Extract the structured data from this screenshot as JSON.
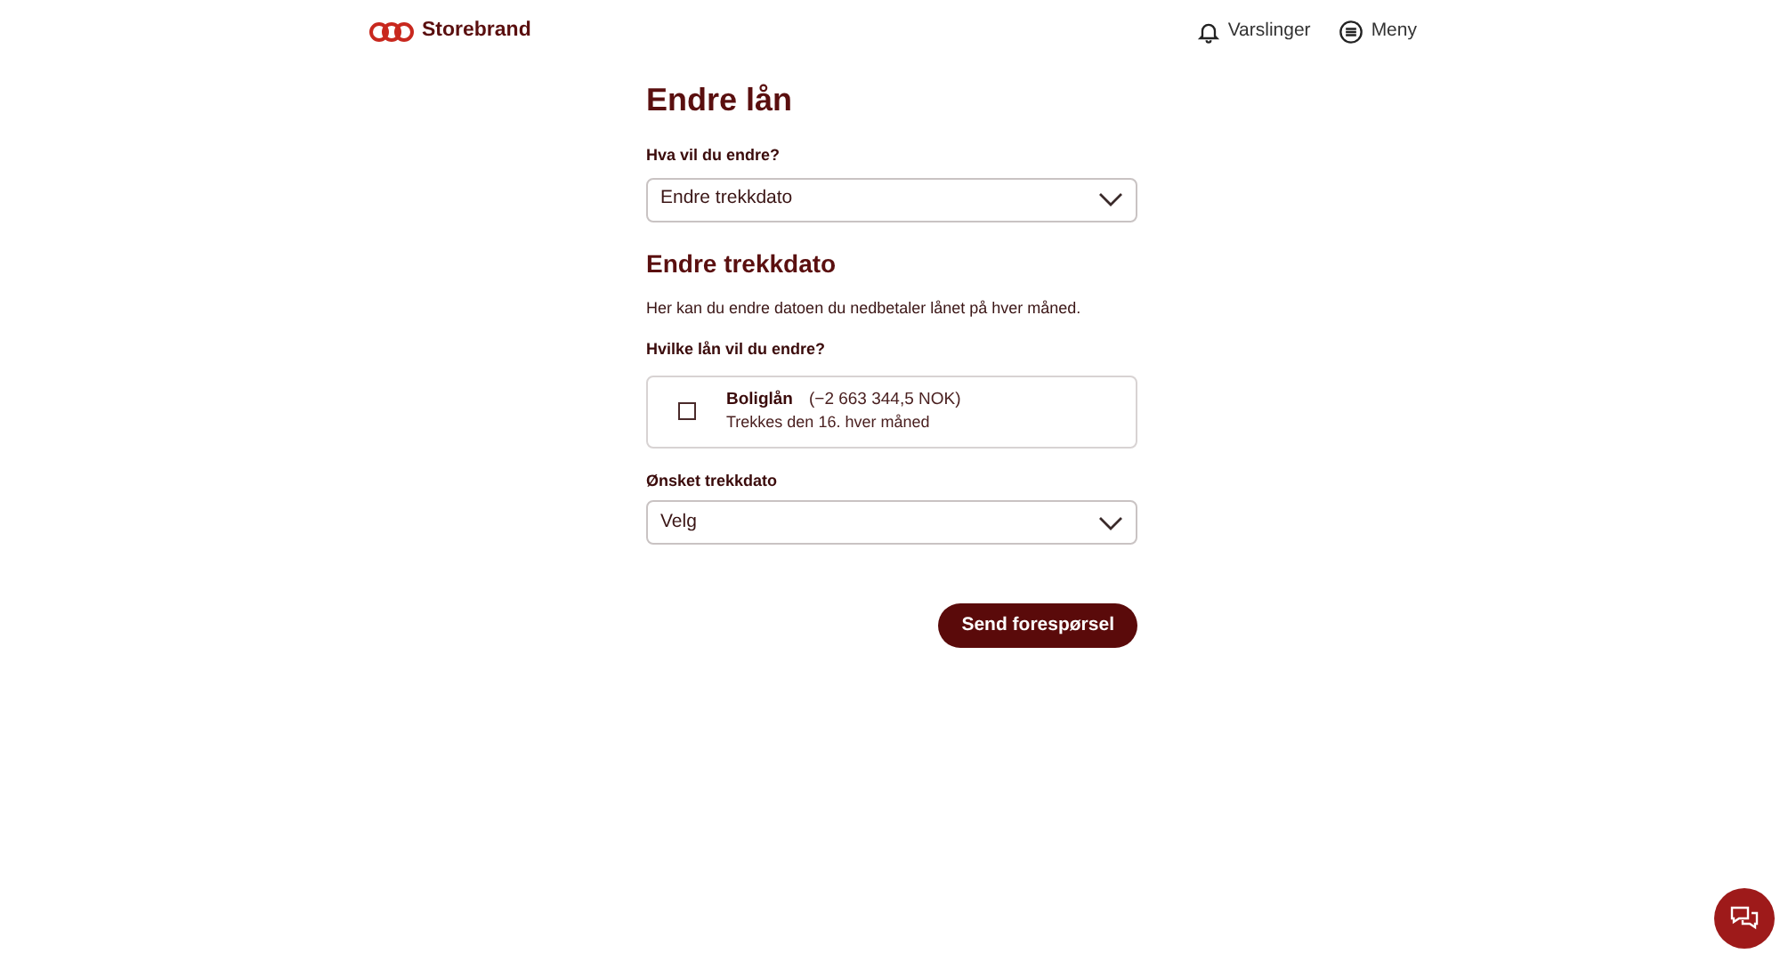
{
  "header": {
    "logo": "Storebrand",
    "nav": [
      {
        "kind": "bell",
        "label": "Varslinger"
      },
      {
        "kind": "menu",
        "label": "Meny"
      }
    ]
  },
  "title": "Endre lån",
  "change_field": {
    "label": "Hva vil du endre?",
    "value": "Endre trekkdato"
  },
  "section": {
    "title": "Endre trekkdato",
    "description": "Her kan du endre datoen du nedbetaler lånet på hver måned."
  },
  "loans": {
    "label": "Hvilke lån vil du endre?",
    "items": [
      {
        "name": "Boliglån",
        "amount": "(−2 663 344,5 NOK)",
        "detail": "Trekkes den 16. hver måned",
        "checked": false
      }
    ]
  },
  "date_field": {
    "label": "Ønsket trekkdato",
    "value": "Velg"
  },
  "submit": "Send forespørsel"
}
